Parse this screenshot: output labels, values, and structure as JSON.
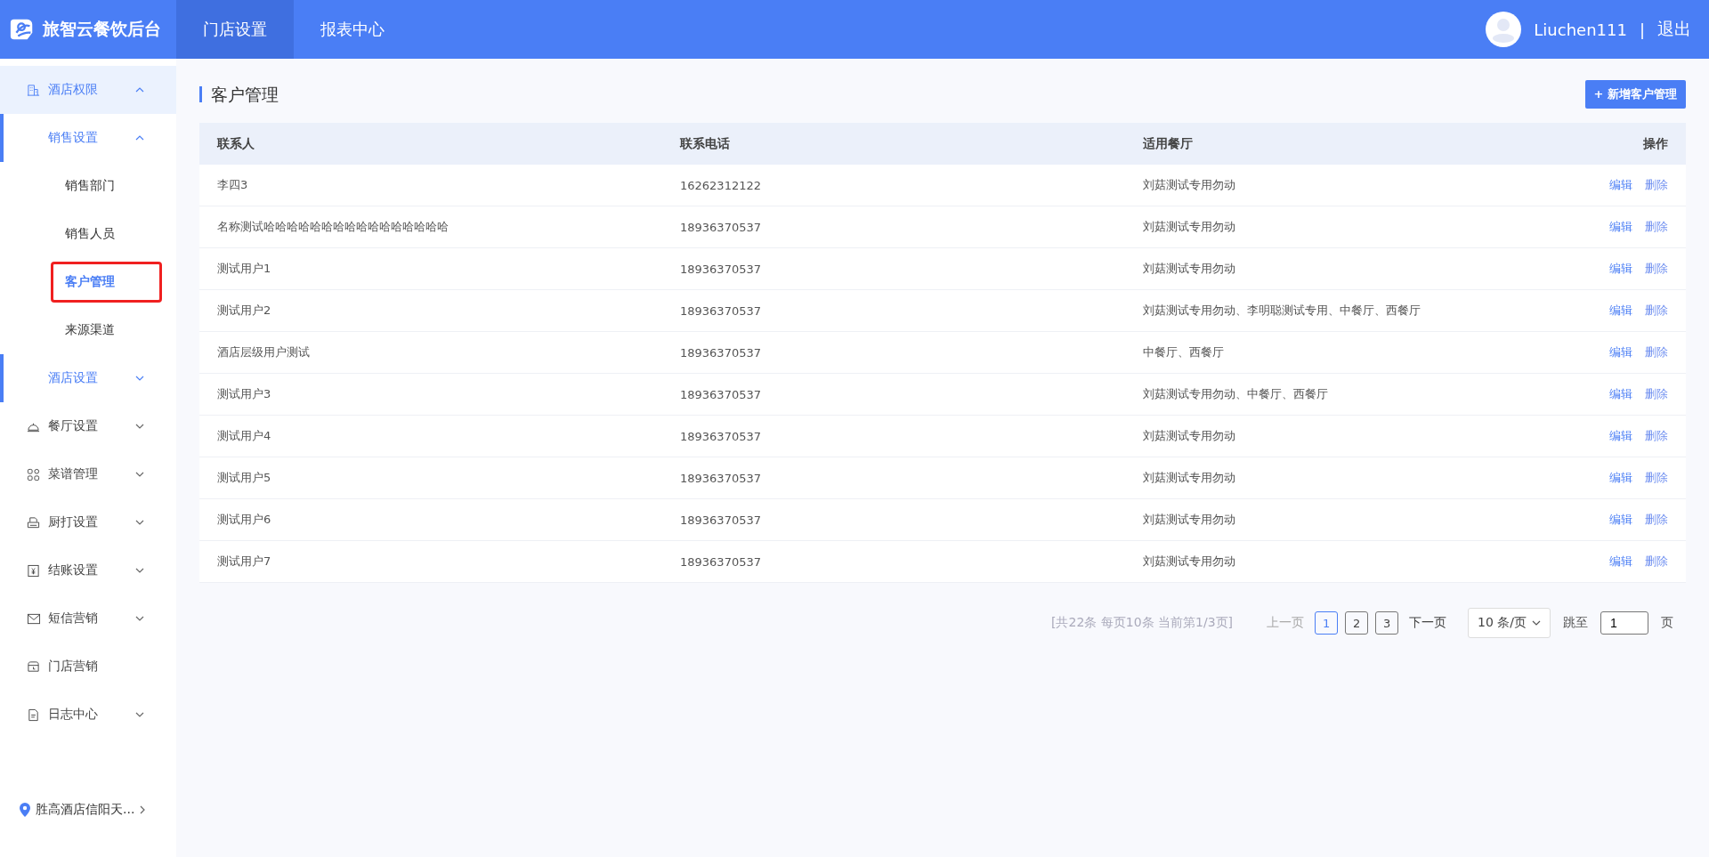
{
  "header": {
    "brand": "旅智云餐饮后台",
    "tabs": [
      {
        "label": "门店设置",
        "selected": true
      },
      {
        "label": "报表中心",
        "selected": false
      }
    ],
    "user": "Liuchen111",
    "separator": "|",
    "logout": "退出"
  },
  "sidebar": {
    "items": [
      {
        "label": "酒店权限",
        "expanded": true,
        "children": [
          {
            "label": "销售设置",
            "expanded": true,
            "children": [
              {
                "label": "销售部门",
                "selected": false
              },
              {
                "label": "销售人员",
                "selected": false
              },
              {
                "label": "客户管理",
                "selected": true
              },
              {
                "label": "来源渠道",
                "selected": false
              }
            ]
          },
          {
            "label": "酒店设置",
            "expanded": false
          }
        ]
      },
      {
        "label": "餐厅设置",
        "expanded": false
      },
      {
        "label": "菜谱管理",
        "expanded": false
      },
      {
        "label": "厨打设置",
        "expanded": false
      },
      {
        "label": "结账设置",
        "expanded": false
      },
      {
        "label": "短信营销",
        "expanded": false
      },
      {
        "label": "门店营销"
      },
      {
        "label": "日志中心",
        "expanded": false
      }
    ],
    "location": "胜高酒店信阳天..."
  },
  "page": {
    "title": "客户管理",
    "add_button": "+ 新增客户管理"
  },
  "table": {
    "columns": [
      "联系人",
      "联系电话",
      "适用餐厅",
      "操作"
    ],
    "rows": [
      {
        "cells": [
          "李四3",
          "16262312122",
          "刘菇测试专用勿动"
        ],
        "actions": [
          "编辑",
          "删除"
        ]
      },
      {
        "cells": [
          "名称测试哈哈哈哈哈哈哈哈哈哈哈哈哈哈哈哈",
          "18936370537",
          "刘菇测试专用勿动"
        ],
        "actions": [
          "编辑",
          "删除"
        ]
      },
      {
        "cells": [
          "测试用户1",
          "18936370537",
          "刘菇测试专用勿动"
        ],
        "actions": [
          "编辑",
          "删除"
        ]
      },
      {
        "cells": [
          "测试用户2",
          "18936370537",
          "刘菇测试专用勿动、李明聪测试专用、中餐厅、西餐厅"
        ],
        "actions": [
          "编辑",
          "删除"
        ]
      },
      {
        "cells": [
          "酒店层级用户测试",
          "18936370537",
          "中餐厅、西餐厅"
        ],
        "actions": [
          "编辑",
          "删除"
        ]
      },
      {
        "cells": [
          "测试用户3",
          "18936370537",
          "刘菇测试专用勿动、中餐厅、西餐厅"
        ],
        "actions": [
          "编辑",
          "删除"
        ]
      },
      {
        "cells": [
          "测试用户4",
          "18936370537",
          "刘菇测试专用勿动"
        ],
        "actions": [
          "编辑",
          "删除"
        ]
      },
      {
        "cells": [
          "测试用户5",
          "18936370537",
          "刘菇测试专用勿动"
        ],
        "actions": [
          "编辑",
          "删除"
        ]
      },
      {
        "cells": [
          "测试用户6",
          "18936370537",
          "刘菇测试专用勿动"
        ],
        "actions": [
          "编辑",
          "删除"
        ]
      },
      {
        "cells": [
          "测试用户7",
          "18936370537",
          "刘菇测试专用勿动"
        ],
        "actions": [
          "编辑",
          "删除"
        ]
      }
    ]
  },
  "pagination": {
    "summary": "[共22条 每页10条 当前第1/3页]",
    "prev": {
      "label": "上一页",
      "disabled": true
    },
    "pages": [
      {
        "label": "1",
        "selected": true
      },
      {
        "label": "2",
        "selected": false
      },
      {
        "label": "3",
        "selected": false
      }
    ],
    "next": {
      "label": "下一页",
      "disabled": false
    },
    "page_size": "10 条/页",
    "jump_label": "跳至",
    "jump_value": "1",
    "jump_unit": "页"
  }
}
